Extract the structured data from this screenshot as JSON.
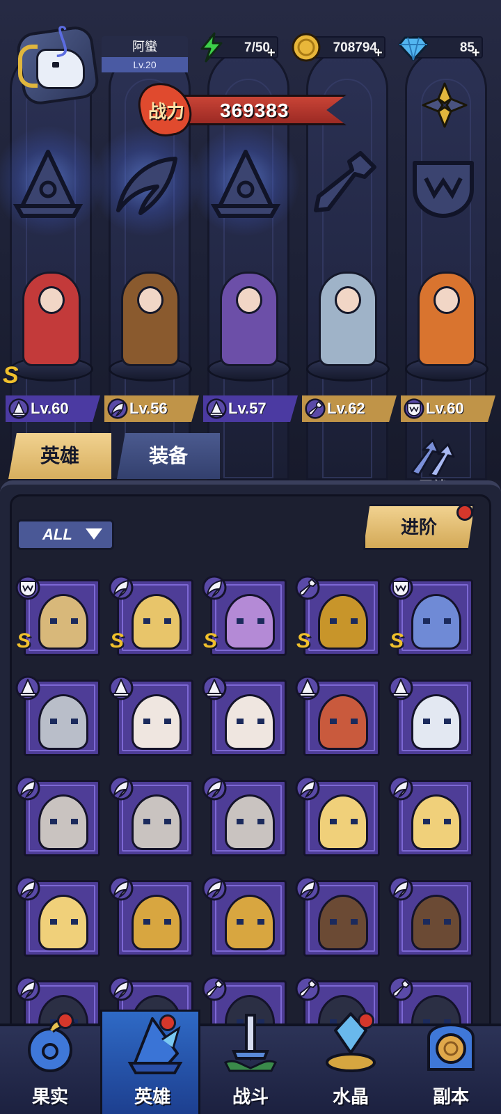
{
  "player": {
    "name": "阿蠻",
    "level": "Lv.20"
  },
  "resources": {
    "stamina": "7/50",
    "gold": "708794",
    "diamonds": "85"
  },
  "power": {
    "label": "战力",
    "value": "369383"
  },
  "lineup": [
    {
      "level": "Lv.60",
      "class_icon": "mage-hat-icon",
      "tag_color": "#4b3aa2",
      "skin": "#c33a3a"
    },
    {
      "level": "Lv.56",
      "class_icon": "wing-icon",
      "tag_color": "#c09448",
      "skin": "#8a5a2e"
    },
    {
      "level": "Lv.57",
      "class_icon": "mage-hat-icon",
      "tag_color": "#4b3aa2",
      "skin": "#6c4fa8"
    },
    {
      "level": "Lv.62",
      "class_icon": "wrench-icon",
      "tag_color": "#c09448",
      "skin": "#9fb3c8"
    },
    {
      "level": "Lv.60",
      "class_icon": "fang-icon",
      "tag_color": "#c09448",
      "skin": "#d9742f"
    }
  ],
  "lineup_rank": "S",
  "tabs": {
    "heroes": "英雄",
    "equipment": "装备",
    "bond": "羁绊"
  },
  "filter": {
    "label": "ALL"
  },
  "advance_button": "进阶",
  "hero_cards": [
    {
      "class_icon": "fang-icon",
      "rank": "S",
      "color": "#d8b87a"
    },
    {
      "class_icon": "wing-icon",
      "rank": "S",
      "color": "#e8c56a"
    },
    {
      "class_icon": "wing-icon",
      "rank": "S",
      "color": "#b48ad6"
    },
    {
      "class_icon": "wrench-icon",
      "rank": "S",
      "color": "#c8952a"
    },
    {
      "class_icon": "fang-icon",
      "rank": "S",
      "color": "#6f8ad6"
    },
    {
      "class_icon": "mage-hat-icon",
      "rank": "",
      "color": "#b9bec9"
    },
    {
      "class_icon": "mage-hat-icon",
      "rank": "",
      "color": "#efe6e0"
    },
    {
      "class_icon": "mage-hat-icon",
      "rank": "",
      "color": "#efe6e0"
    },
    {
      "class_icon": "mage-hat-icon",
      "rank": "",
      "color": "#c95a3d"
    },
    {
      "class_icon": "mage-hat-icon",
      "rank": "",
      "color": "#e3e8f2"
    },
    {
      "class_icon": "wing-icon",
      "rank": "",
      "color": "#c9c3c0"
    },
    {
      "class_icon": "wing-icon",
      "rank": "",
      "color": "#c9c3c0"
    },
    {
      "class_icon": "wing-icon",
      "rank": "",
      "color": "#c9c3c0"
    },
    {
      "class_icon": "wing-icon",
      "rank": "",
      "color": "#f0d07a"
    },
    {
      "class_icon": "wing-icon",
      "rank": "",
      "color": "#f0d07a"
    },
    {
      "class_icon": "wing-icon",
      "rank": "",
      "color": "#f0d07a"
    },
    {
      "class_icon": "wing-icon",
      "rank": "",
      "color": "#d8a640"
    },
    {
      "class_icon": "wing-icon",
      "rank": "",
      "color": "#d8a640"
    },
    {
      "class_icon": "wing-icon",
      "rank": "",
      "color": "#6b4a34"
    },
    {
      "class_icon": "wing-icon",
      "rank": "",
      "color": "#6b4a34"
    },
    {
      "class_icon": "wing-icon",
      "rank": "",
      "color": "#2b2f44"
    },
    {
      "class_icon": "wing-icon",
      "rank": "",
      "color": "#2b2f44"
    },
    {
      "class_icon": "wrench-icon",
      "rank": "",
      "color": "#2b2f44"
    },
    {
      "class_icon": "wrench-icon",
      "rank": "",
      "color": "#2b2f44"
    },
    {
      "class_icon": "wrench-icon",
      "rank": "",
      "color": "#2b2f44"
    }
  ],
  "bottom_nav": [
    {
      "label": "果实",
      "icon": "fruit-icon",
      "active": false,
      "badge": true
    },
    {
      "label": "英雄",
      "icon": "hero-hat-icon",
      "active": true,
      "badge": true
    },
    {
      "label": "战斗",
      "icon": "sword-icon",
      "active": false,
      "badge": false
    },
    {
      "label": "水晶",
      "icon": "crystal-icon",
      "active": false,
      "badge": true
    },
    {
      "label": "副本",
      "icon": "portal-icon",
      "active": false,
      "badge": false
    }
  ]
}
